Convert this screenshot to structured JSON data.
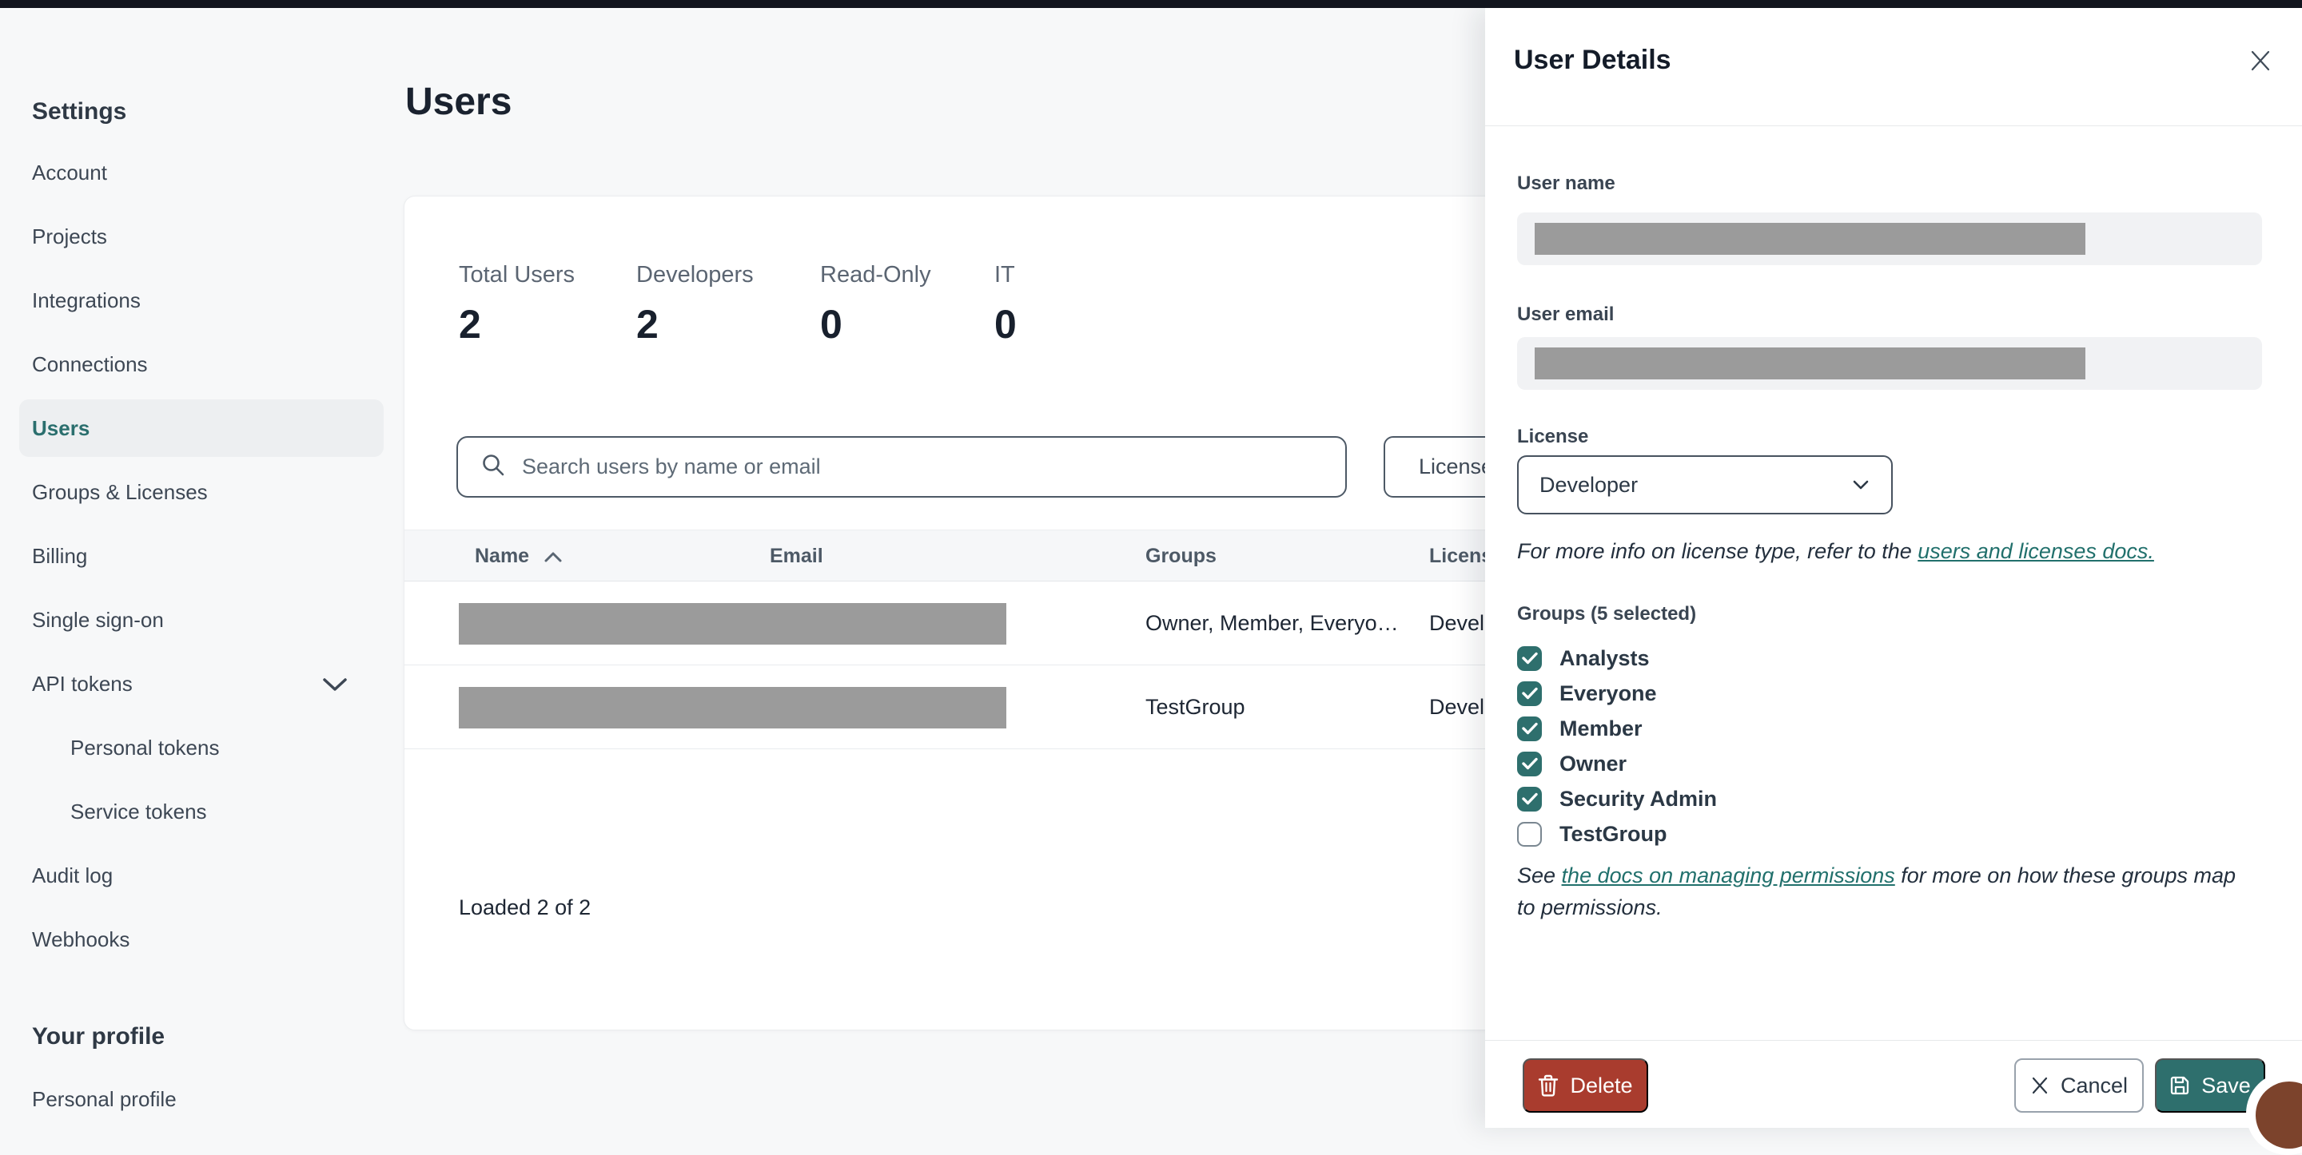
{
  "sidebar": {
    "section_title": "Settings",
    "items": [
      {
        "label": "Account",
        "active": false
      },
      {
        "label": "Projects",
        "active": false
      },
      {
        "label": "Integrations",
        "active": false
      },
      {
        "label": "Connections",
        "active": false
      },
      {
        "label": "Users",
        "active": true
      },
      {
        "label": "Groups & Licenses",
        "active": false
      },
      {
        "label": "Billing",
        "active": false
      },
      {
        "label": "Single sign-on",
        "active": false
      },
      {
        "label": "API tokens",
        "active": false,
        "expanded": true,
        "icon": "chevron-down-icon"
      },
      {
        "label": "Personal tokens",
        "active": false,
        "indent": true
      },
      {
        "label": "Service tokens",
        "active": false,
        "indent": true
      },
      {
        "label": "Audit log",
        "active": false
      },
      {
        "label": "Webhooks",
        "active": false
      }
    ],
    "profile_section_title": "Your profile",
    "profile_items": [
      {
        "label": "Personal profile"
      }
    ]
  },
  "main": {
    "title": "Users",
    "stats": [
      {
        "label": "Total Users",
        "value": "2"
      },
      {
        "label": "Developers",
        "value": "2"
      },
      {
        "label": "Read-Only",
        "value": "0"
      },
      {
        "label": "IT",
        "value": "0"
      }
    ],
    "search_placeholder": "Search users by name or email",
    "search_icon": "search-icon",
    "license_filter_label": "License",
    "table": {
      "columns": {
        "name": "Name",
        "email": "Email",
        "groups": "Groups",
        "license": "License"
      },
      "sort": {
        "column": "Name",
        "direction": "ascending",
        "icon": "chevron-up-icon"
      },
      "rows": [
        {
          "name": "[redacted]",
          "email": "[redacted]",
          "groups": "Owner, Member, Everyo…",
          "license": "Developer"
        },
        {
          "name": "[redacted]",
          "email": "[redacted]",
          "groups": "TestGroup",
          "license": "Developer"
        }
      ],
      "footer": "Loaded 2 of 2"
    }
  },
  "panel": {
    "title": "User Details",
    "close_icon": "close-icon",
    "user_name": {
      "label": "User name",
      "value": "[redacted]"
    },
    "user_email": {
      "label": "User email",
      "value": "[redacted]"
    },
    "license": {
      "label": "License",
      "value": "Developer",
      "icon": "chevron-down-icon"
    },
    "license_note_prefix": "For more info on license type, refer to the ",
    "license_note_link": "users and licenses docs.",
    "groups_label": "Groups (5 selected)",
    "groups": [
      {
        "label": "Analysts",
        "checked": true
      },
      {
        "label": "Everyone",
        "checked": true
      },
      {
        "label": "Member",
        "checked": true
      },
      {
        "label": "Owner",
        "checked": true
      },
      {
        "label": "Security Admin",
        "checked": true
      },
      {
        "label": "TestGroup",
        "checked": false
      }
    ],
    "permissions_note_prefix": "See ",
    "permissions_note_link": "the docs on managing permissions",
    "permissions_note_suffix": " for more on how these groups map to permissions.",
    "buttons": {
      "delete": "Delete",
      "cancel": "Cancel",
      "save": "Save",
      "delete_icon": "trash-icon",
      "cancel_icon": "close-icon",
      "save_icon": "save-disk-icon"
    }
  },
  "colors": {
    "accent_teal": "#2e6f6d",
    "link_teal": "#21706c",
    "delete_red": "#a93c2e",
    "redaction_gray": "#9b9b9b",
    "topbar_black": "#12151e",
    "chat_bubble_brown": "#7c432c"
  }
}
